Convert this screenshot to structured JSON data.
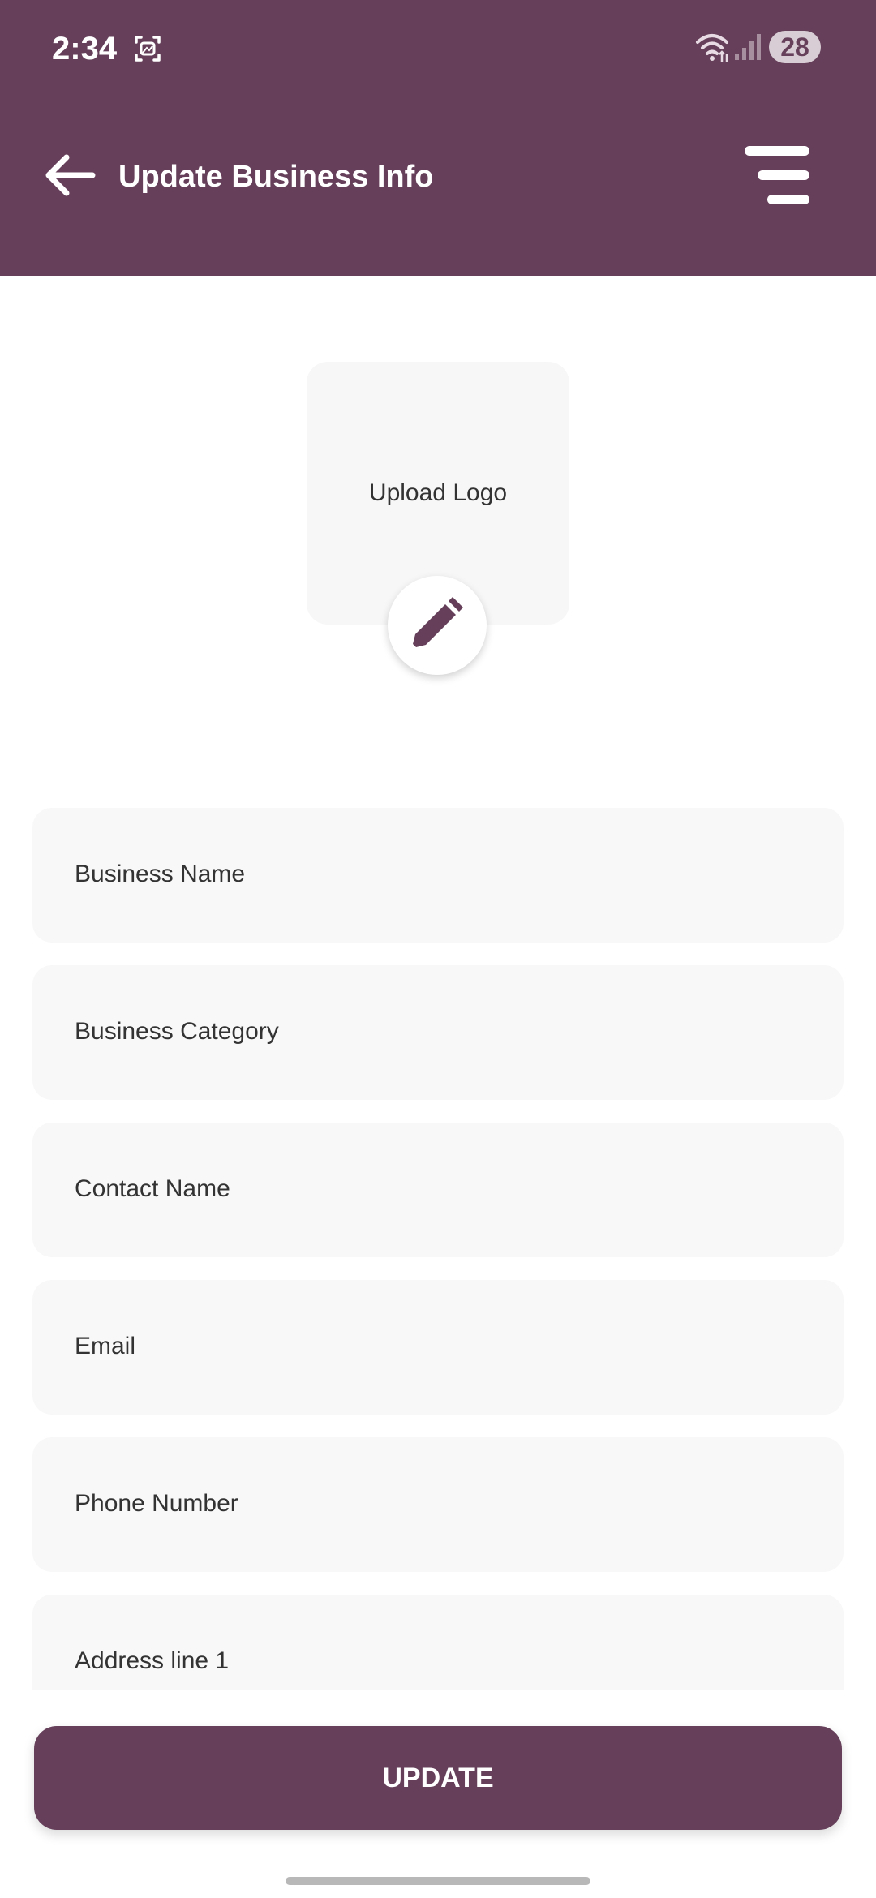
{
  "status_bar": {
    "time": "2:34",
    "battery": "28",
    "icons": [
      "screenshot-icon",
      "wifi-icon",
      "signal-icon"
    ]
  },
  "header": {
    "title": "Update Business Info",
    "back_icon": "back-arrow-icon",
    "menu_icon": "menu-icon"
  },
  "logo": {
    "label": "Upload Logo",
    "edit_icon": "pencil-icon"
  },
  "form": {
    "fields": [
      {
        "label": "Business Name"
      },
      {
        "label": "Business Category"
      },
      {
        "label": "Contact Name"
      },
      {
        "label": "Email"
      },
      {
        "label": "Phone Number"
      },
      {
        "label": "Address line 1"
      }
    ]
  },
  "actions": {
    "update_label": "UPDATE"
  },
  "colors": {
    "brand": "#66405a",
    "field_background": "#f8f8f8",
    "text": "#333333"
  }
}
